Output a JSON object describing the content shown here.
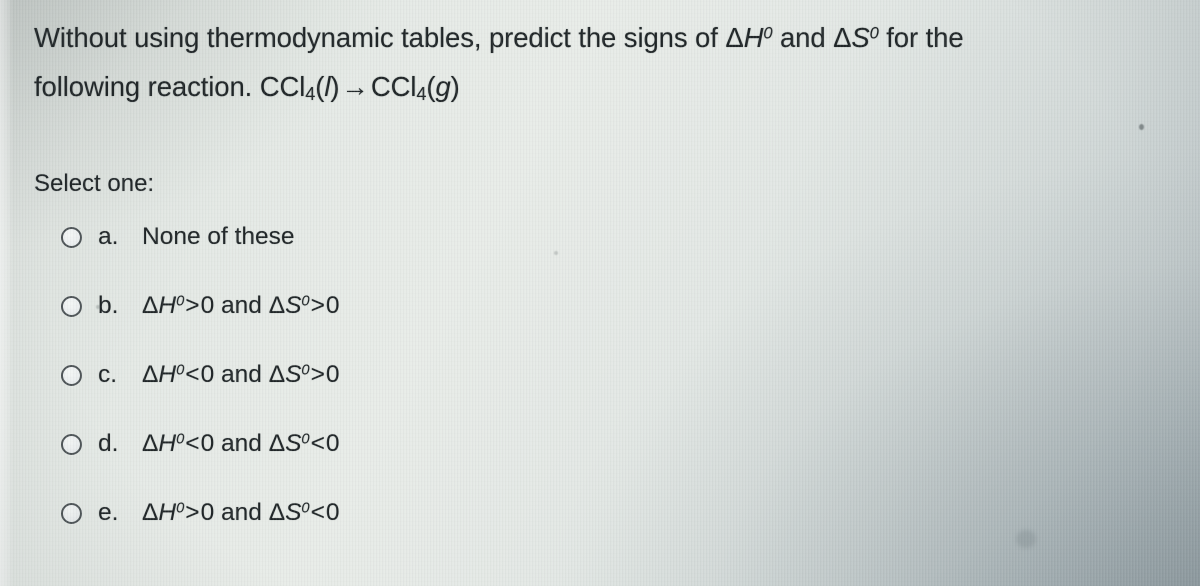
{
  "question": {
    "line1_part1": "Without using thermodynamic tables, predict the signs of ",
    "delta": "Δ",
    "h_symbol": "H",
    "s_symbol": "S",
    "superscript_zero": "0",
    "line1_and": " and ",
    "line1_part2": " for the",
    "line2_prefix": "following reaction. ",
    "reactant_formula": "CCl",
    "reactant_sub": "4",
    "reactant_state": "l",
    "arrow": "→",
    "product_formula": "CCl",
    "product_sub": "4",
    "product_state": "g"
  },
  "select_one_label": "Select one:",
  "options": [
    {
      "letter": "a.",
      "type": "plain",
      "text": "None of these"
    },
    {
      "letter": "b.",
      "type": "expression",
      "h_comparison": ">",
      "h_value": "0",
      "conjunction": " and ",
      "s_comparison": ">",
      "s_value": "0",
      "plain_text": "ΔH⁰ > 0 and ΔS⁰ > 0"
    },
    {
      "letter": "c.",
      "type": "expression",
      "h_comparison": "<",
      "h_value": "0",
      "conjunction": " and ",
      "s_comparison": ">",
      "s_value": "0",
      "plain_text": "ΔH⁰ < 0 and ΔS⁰ > 0"
    },
    {
      "letter": "d.",
      "type": "expression",
      "h_comparison": "<",
      "h_value": "0",
      "conjunction": " and ",
      "s_comparison": "<",
      "s_value": "0",
      "plain_text": "ΔH⁰ < 0 and ΔS⁰ < 0"
    },
    {
      "letter": "e.",
      "type": "expression",
      "h_comparison": ">",
      "h_value": "0",
      "conjunction": " and ",
      "s_comparison": "<",
      "s_value": "0",
      "plain_text": "ΔH⁰ > 0 and ΔS⁰ < 0"
    }
  ],
  "selected_option": null,
  "colors": {
    "text": "#1e2426",
    "radio_ring": "#4c5356",
    "background_light": "#e8ece8",
    "background_shadow": "#adb7ba"
  }
}
